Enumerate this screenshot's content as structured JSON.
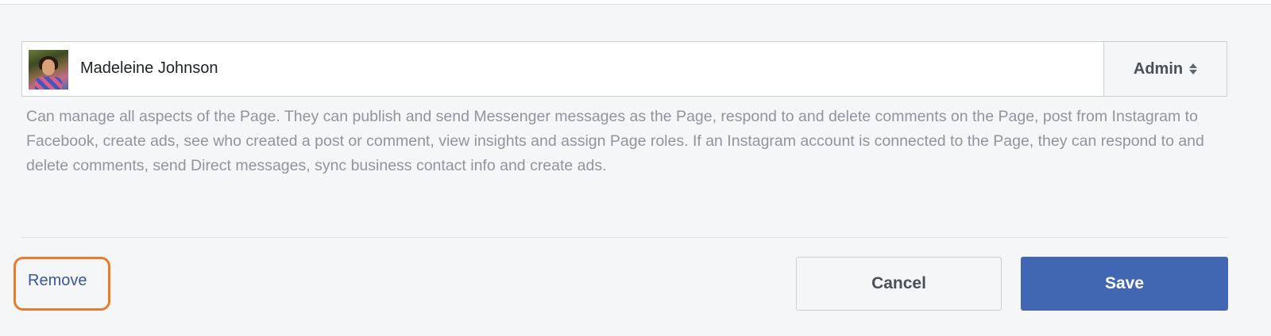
{
  "user": {
    "name": "Madeleine Johnson",
    "avatar_icon": "user-photo"
  },
  "role": {
    "selected": "Admin",
    "icon": "updown-arrows-icon",
    "description": "Can manage all aspects of the Page. They can publish and send Messenger messages as the Page, respond to and delete comments on the Page, post from Instagram to Facebook, create ads, see who created a post or comment, view insights and assign Page roles. If an Instagram account is connected to the Page, they can respond to and delete comments, send Direct messages, sync business contact info and create ads."
  },
  "actions": {
    "remove_label": "Remove",
    "cancel_label": "Cancel",
    "save_label": "Save"
  },
  "colors": {
    "save_bg": "#4267b2",
    "link": "#385898",
    "highlight": "#ea7a2e",
    "description_text": "#90949c"
  }
}
